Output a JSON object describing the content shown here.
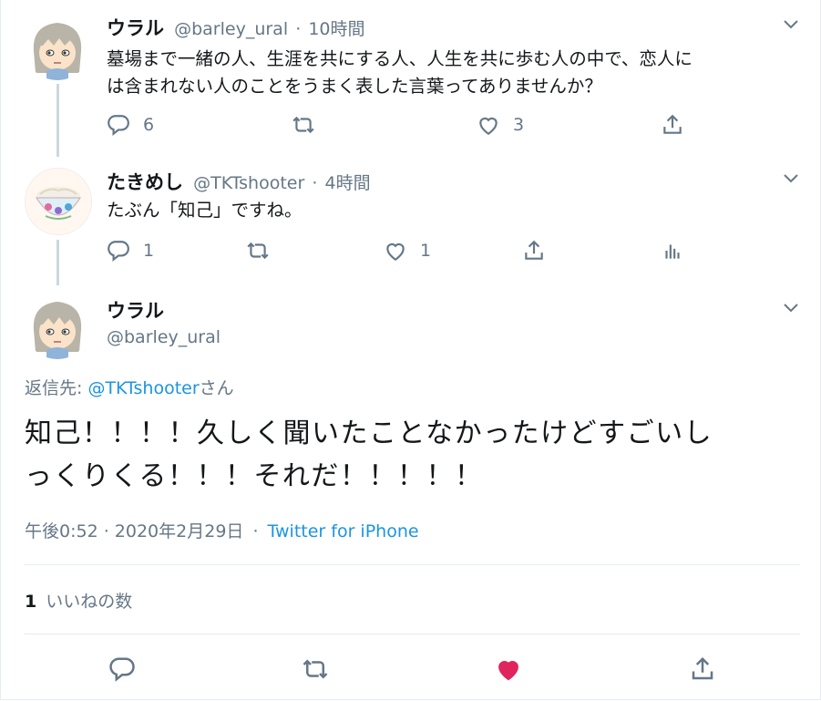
{
  "thread": [
    {
      "display_name": "ウラル",
      "handle": "@barley_ural",
      "separator": "·",
      "time": "10時間",
      "text_line1": "墓場まで一緒の人、生涯を共にする人、人生を共に歩む人の中で、恋人に",
      "text_line2": "は含まれない人のことをうまく表した言葉ってありませんか？",
      "reply_count": "6",
      "like_count": "3"
    },
    {
      "display_name": "たきめし",
      "handle": "@TKTshooter",
      "separator": "·",
      "time": "4時間",
      "text": "たぶん「知己」ですね。",
      "reply_count": "1",
      "like_count": "1"
    }
  ],
  "focused": {
    "display_name": "ウラル",
    "handle": "@barley_ural",
    "reply_to_prefix": "返信先: ",
    "reply_to_handle": "@TKTshooter",
    "reply_to_suffix": "さん",
    "text_line1": "知己！！！！久しく聞いたことなかったけどすごいし",
    "text_line2": "っくりくる！！！それだ！！！！！",
    "timestamp": "午後0:52 · 2020年2月29日",
    "meta_separator": "·",
    "source": "Twitter for iPhone",
    "likes_count": "1",
    "likes_label": "いいねの数"
  },
  "colors": {
    "accent": "#1b95e0",
    "like_active": "#e0245e",
    "muted": "#657786",
    "border": "#e6ecf0"
  },
  "icons": {
    "reply": "reply-icon",
    "retweet": "retweet-icon",
    "like": "heart-icon",
    "share": "share-icon",
    "analytics": "analytics-icon",
    "menu": "chevron-down-icon"
  }
}
